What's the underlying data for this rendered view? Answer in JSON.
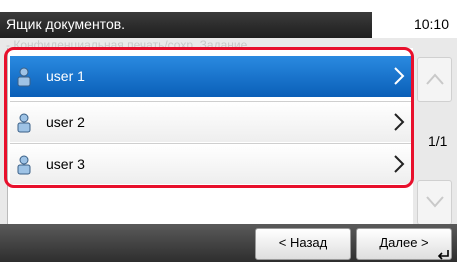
{
  "header": {
    "title": "Ящик документов.",
    "subtitle": "- Конфиденциальная печать/сохр. Задание",
    "time": "10:10"
  },
  "list": {
    "items": [
      {
        "label": "user 1",
        "selected": true
      },
      {
        "label": "user 2",
        "selected": false
      },
      {
        "label": "user 3",
        "selected": false
      }
    ]
  },
  "pagination": {
    "page_label": "1/1"
  },
  "footer": {
    "back_label": "< Назад",
    "next_label": "Далее >"
  },
  "icons": {
    "user": "user-icon",
    "chevron": "chevron-right-icon",
    "scroll_up": "arrow-up-icon",
    "scroll_down": "arrow-down-icon",
    "enter": "enter-key-icon"
  },
  "colors": {
    "selected_row": "#1a72cc",
    "selection_outline": "#e8102c",
    "title_bar": "#2a2a2a"
  }
}
